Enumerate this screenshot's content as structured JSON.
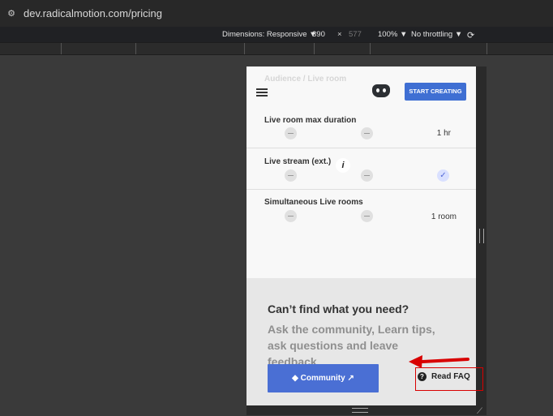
{
  "browser": {
    "url": "dev.radicalmotion.com/pricing",
    "site_info_icon": "site-info-icon"
  },
  "devtools": {
    "dimensions_label": "Dimensions: Responsive",
    "width": "390",
    "separator": "×",
    "height": "577",
    "zoom": "100%",
    "throttling": "No throttling",
    "rotate_icon": "rotate-icon"
  },
  "page": {
    "header": {
      "faded_row_label": "Audience / Live room",
      "start_button": "START CREATING"
    },
    "rows": [
      {
        "label": "Live room max duration",
        "value": "1 hr"
      },
      {
        "label": "Live stream (ext.)",
        "value": "",
        "info": "i"
      },
      {
        "label": "Simultaneous Live rooms",
        "value": "1 room"
      }
    ],
    "faq": {
      "title": "Can’t find what you need?",
      "description": "Ask the community, Learn tips, ask questions and leave feedback",
      "community_button": "Community",
      "read_faq": "Read FAQ"
    }
  },
  "colors": {
    "accent": "#3f6fd3",
    "annotation": "#d80000"
  }
}
